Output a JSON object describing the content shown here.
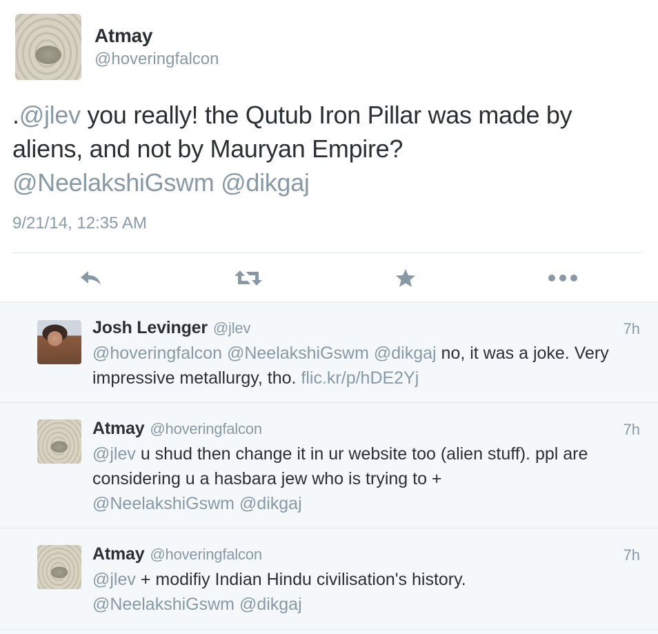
{
  "main_tweet": {
    "author_name": "Atmay",
    "author_handle": "@hoveringfalcon",
    "text_prefix": ".",
    "mention_jlev": "@jlev",
    "text_body": " you really! the Qutub Iron Pillar was made by aliens, and not by Mauryan Empire?",
    "mention_neelakshi": "@NeelakshiGswm",
    "mention_dikgaj": "@dikgaj",
    "timestamp": "9/21/14, 12:35 AM",
    "actions": [
      "reply-icon",
      "retweet-icon",
      "favorite-star-icon",
      "more-dots-icon"
    ]
  },
  "replies": [
    {
      "name": "Josh Levinger",
      "handle": "@jlev",
      "time": "7h",
      "avatar": "josh-photo",
      "mention1": "@hoveringfalcon",
      "mention2": "@NeelakshiGswm",
      "mention3": "@dikgaj",
      "text": " no, it was a joke. Very impressive metallurgy, tho. ",
      "link": "flic.kr/p/hDE2Yj"
    },
    {
      "name": "Atmay",
      "handle": "@hoveringfalcon",
      "time": "7h",
      "avatar": "zen-sand-stone",
      "mention_lead": "@jlev",
      "text": " u shud then change it in ur website too (alien stuff). ppl are considering u a hasbara jew who is trying to +",
      "mention2": "@NeelakshiGswm",
      "mention3": "@dikgaj"
    },
    {
      "name": "Atmay",
      "handle": "@hoveringfalcon",
      "time": "7h",
      "avatar": "zen-sand-stone",
      "mention_lead": "@jlev",
      "text": " + modifiy Indian Hindu civilisation's history.",
      "mention2": "@NeelakshiGswm",
      "mention3": "@dikgaj"
    }
  ],
  "colors": {
    "text": "#292f33",
    "muted": "#8899a6",
    "reply_bg": "#f5f8fa",
    "border": "#e1e8ed"
  }
}
